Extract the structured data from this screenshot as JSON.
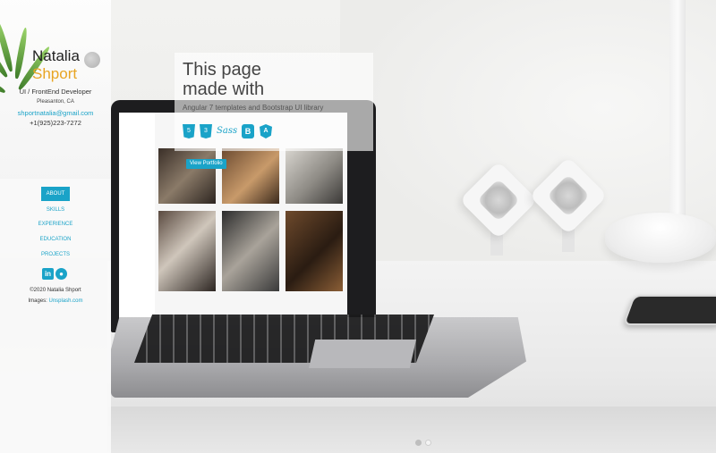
{
  "profile": {
    "first_name": "Natalia",
    "last_name": "Shport",
    "location": "Pleasanton, CA",
    "role": "UI / FrontEnd Developer",
    "email": "shportnatalia@gmail.com",
    "phone": "+1(925)223-7272"
  },
  "nav": {
    "items": [
      "ABOUT",
      "SKILLS",
      "EXPERIENCE",
      "EDUCATION",
      "PROJECTS"
    ],
    "active": "ABOUT"
  },
  "social": {
    "linkedin_icon": "linkedin-icon",
    "github_icon": "github-icon",
    "linkedin_glyph": "in",
    "github_glyph": "●"
  },
  "footer": {
    "copyright": "©2020 Natalia Shport",
    "images_label": "Images:",
    "images_link": "Unsplash.com"
  },
  "hero": {
    "title_line1": "This page",
    "title_line2": "made with",
    "subtitle": "Angular 7 templates and Bootstrap UI library",
    "tech": [
      {
        "icon": "html5-icon",
        "glyph": "5"
      },
      {
        "icon": "css3-icon",
        "glyph": "3"
      },
      {
        "icon": "sass-icon",
        "glyph": "Sass"
      },
      {
        "icon": "bootstrap-icon",
        "glyph": "B"
      },
      {
        "icon": "angular-icon",
        "glyph": "A"
      }
    ]
  },
  "laptop_screen": {
    "button_label": "View Portfolio"
  },
  "carousel": {
    "slides": 2,
    "active_index": 2
  },
  "colors": {
    "accent": "#1aa3c8",
    "name_highlight": "#e8a523"
  }
}
